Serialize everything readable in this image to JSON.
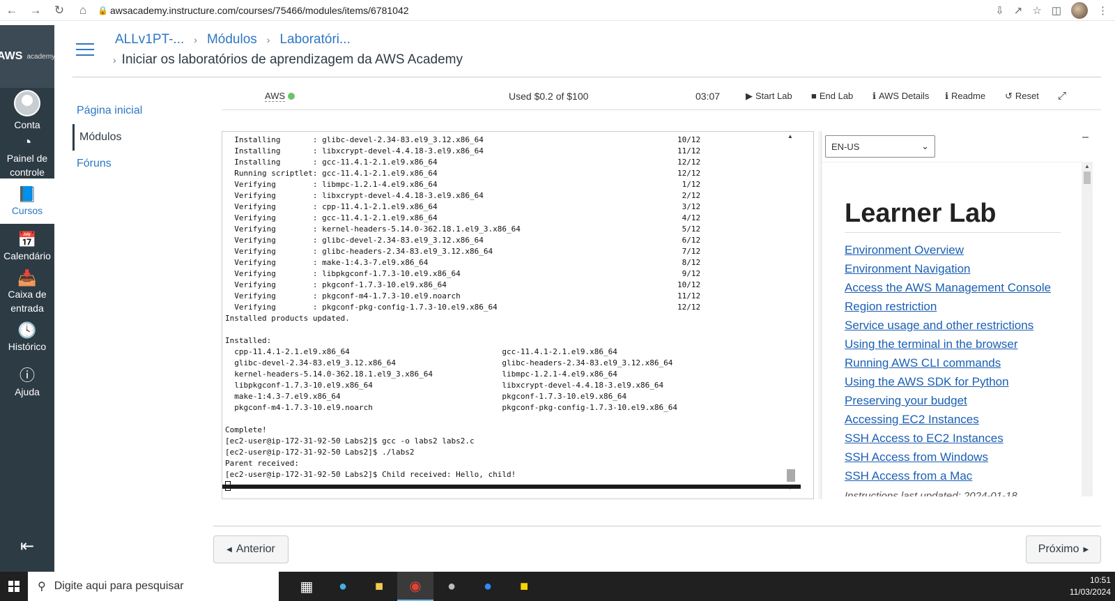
{
  "browser": {
    "url": "awsacademy.instructure.com/courses/75466/modules/items/6781042"
  },
  "global_nav": {
    "logo_text": "AWS",
    "logo_sub": "academy",
    "items": [
      {
        "label": "Conta"
      },
      {
        "label": "Painel de controle"
      },
      {
        "label": "Cursos"
      },
      {
        "label": "Calendário"
      },
      {
        "label": "Caixa de entrada"
      },
      {
        "label": "Histórico"
      },
      {
        "label": "Ajuda"
      }
    ]
  },
  "breadcrumb": {
    "items": [
      "ALLv1PT-...",
      "Módulos",
      "Laboratóri..."
    ],
    "current": "Iniciar os laboratórios de aprendizagem da AWS Academy"
  },
  "course_nav": {
    "items": [
      "Página inicial",
      "Módulos",
      "Fóruns"
    ]
  },
  "lab_bar": {
    "aws_label": "AWS",
    "status_color": "#69c469",
    "used": "Used $0.2 of $100",
    "timer": "03:07",
    "start_lab": "Start Lab",
    "end_lab": "End Lab",
    "aws_details": "AWS Details",
    "readme": "Readme",
    "reset": "Reset"
  },
  "terminal": {
    "lines": [
      "  Installing       : glibc-devel-2.34-83.el9_3.12.x86_64                                          10/12",
      "  Installing       : libxcrypt-devel-4.4.18-3.el9.x86_64                                          11/12",
      "  Installing       : gcc-11.4.1-2.1.el9.x86_64                                                    12/12",
      "  Running scriptlet: gcc-11.4.1-2.1.el9.x86_64                                                    12/12",
      "  Verifying        : libmpc-1.2.1-4.el9.x86_64                                                     1/12",
      "  Verifying        : libxcrypt-devel-4.4.18-3.el9.x86_64                                           2/12",
      "  Verifying        : cpp-11.4.1-2.1.el9.x86_64                                                     3/12",
      "  Verifying        : gcc-11.4.1-2.1.el9.x86_64                                                     4/12",
      "  Verifying        : kernel-headers-5.14.0-362.18.1.el9_3.x86_64                                   5/12",
      "  Verifying        : glibc-devel-2.34-83.el9_3.12.x86_64                                           6/12",
      "  Verifying        : glibc-headers-2.34-83.el9_3.12.x86_64                                         7/12",
      "  Verifying        : make-1:4.3-7.el9.x86_64                                                       8/12",
      "  Verifying        : libpkgconf-1.7.3-10.el9.x86_64                                                9/12",
      "  Verifying        : pkgconf-1.7.3-10.el9.x86_64                                                  10/12",
      "  Verifying        : pkgconf-m4-1.7.3-10.el9.noarch                                               11/12",
      "  Verifying        : pkgconf-pkg-config-1.7.3-10.el9.x86_64                                       12/12",
      "Installed products updated.",
      "",
      "Installed:",
      "  cpp-11.4.1-2.1.el9.x86_64                                 gcc-11.4.1-2.1.el9.x86_64",
      "  glibc-devel-2.34-83.el9_3.12.x86_64                       glibc-headers-2.34-83.el9_3.12.x86_64",
      "  kernel-headers-5.14.0-362.18.1.el9_3.x86_64               libmpc-1.2.1-4.el9.x86_64",
      "  libpkgconf-1.7.3-10.el9.x86_64                            libxcrypt-devel-4.4.18-3.el9.x86_64",
      "  make-1:4.3-7.el9.x86_64                                   pkgconf-1.7.3-10.el9.x86_64",
      "  pkgconf-m4-1.7.3-10.el9.noarch                            pkgconf-pkg-config-1.7.3-10.el9.x86_64",
      "",
      "Complete!",
      "[ec2-user@ip-172-31-92-50 Labs2]$ gcc -o labs2 labs2.c",
      "[ec2-user@ip-172-31-92-50 Labs2]$ ./labs2",
      "Parent received:",
      "[ec2-user@ip-172-31-92-50 Labs2]$ Child received: Hello, child!"
    ]
  },
  "readme": {
    "language": "EN-US",
    "title": "Learner Lab",
    "links": [
      "Environment Overview",
      "Environment Navigation",
      "Access the AWS Management Console",
      "Region restriction",
      "Service usage and other restrictions",
      "Using the terminal in the browser",
      "Running AWS CLI commands",
      "Using the AWS SDK for Python",
      "Preserving your budget",
      "Accessing EC2 Instances",
      "SSH Access to EC2 Instances",
      "SSH Access from Windows",
      "SSH Access from a Mac"
    ],
    "footer": "Instructions last updated: 2024-01-18"
  },
  "pager": {
    "prev": "Anterior",
    "next": "Próximo"
  },
  "taskbar": {
    "search_placeholder": "Digite aqui para pesquisar",
    "time": "10:51",
    "date": "11/03/2024"
  }
}
